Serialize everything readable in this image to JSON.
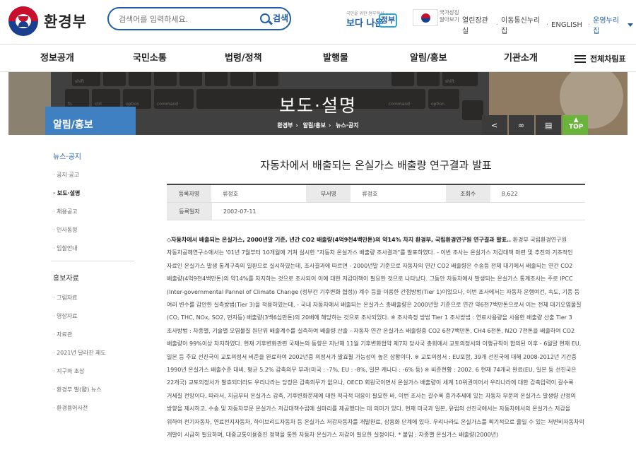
{
  "header": {
    "logo_text": "환경부",
    "search_placeholder": "검색어를 입력하세요.",
    "search_button": "검색",
    "better_gov_small": "국민을 위한 정부혁신",
    "better_gov_big": "보다 나은",
    "better_gov_tag": "정부",
    "flag_text": "국가상징 알아보기",
    "util_links": [
      "열린장관실",
      "이동통신누리집",
      "ENGLISH"
    ],
    "util_ops": "운영누리집"
  },
  "gnb": {
    "items": [
      "정보공개",
      "국민소통",
      "법령/정책",
      "발행물",
      "알림/홍보",
      "기관소개"
    ],
    "all_menu": "전체차림표"
  },
  "banner": {
    "title": "보도·설명",
    "breadcrumb": [
      "환경부",
      "알림/홍보",
      "뉴스·공지"
    ],
    "section": "알림/홍보",
    "top_label": "TOP"
  },
  "lnb": {
    "group1": "뉴스·공지",
    "group1_items": [
      "공지·공고",
      "보도·설명",
      "채용공고",
      "인사동정",
      "입찰안내"
    ],
    "active_item": "보도·설명",
    "group2": "홍보자료",
    "group2_items": [
      "그림자료",
      "영상자료",
      "자료관",
      "2021년 달라진 제도",
      "지구의 초상",
      "환경부 발(發) 뉴스",
      "환경용어사전"
    ]
  },
  "article": {
    "title": "자동차에서 배출되는 온실가스 배출량 연구결과 발표",
    "meta": {
      "author_label": "등록자명",
      "author": "류정호",
      "dept_label": "부서명",
      "dept": "류정호",
      "views_label": "조회수",
      "views": "8,622",
      "date_label": "등록일자",
      "date": "2002-07-11"
    },
    "lead": "◇자동차에서 배출되는 온실가스, 2000년말 기준, 년간 CO2 배출량(4억9천4백만톤)의 약14% 차지 환경부, 국립환경연구원 연구결과 발표..",
    "body": " 환경부 국립환경연구원 자동차공해연구소에서는 '01년 7월부터 10개월에 거쳐 실시한 \"자동차 온실가스 배출량 조사결과\"를 발표하였다. - 이번 조사는 온실가스 저감대책 마련 및 추진의 기초적인 자료인 온실가스 발생 통계구축의 일환으로 실시하였는데, 조사결과에 따르면 - 2000년말 기준으로 자동차의 연간 CO2 배출량은 수송등 전체 대기에서 배출되는 연간 CO2 배출량(4억9천4백만톤)의 약14%를 차지하는 것으로 조사되어 이에 대한 저감대책이 필요한 것으로 나타났다. 그동안 자동차에서 발생되는 온실가스 통계조사는 주로 IPCC (Inter-governmental Pannel of Climate Change (정부간 기후변화 협정)) 계수 등을 이용한 간접방법(Tier 1)이었으나, 이번 조사에서는 자동차 운행여건, 속도, 기종 등 여러 변수를 감안한 실측방법(Tier 3)을 적용하였는데, - 국내 자동차에서 배출되는 온실가스 총배출량은 2000년말 기준으로 연간 약6천7백만톤으로서 이는 전체 대기오염물질(CO, THC, NOx, SO2, 먼지등) 배출량(3백6십만톤)의 20배에 해당하는 것으로 조사되었다. ※ 조사측정 방법 Tier 1 조사방법 : 연료사용량을 사용한 배출량 산출 Tier 3 조사방법 : 차종별, 기술별 오염물질 원단위 배출계수를 실측하여 배출량 산출 - 자동차 연간 온실가스 배출량중 CO2 6천7백만톤, CH4 6천톤, N2O 7천톤을 배출하여 CO2 배출량이 99%이상 차지하였다. 현재 기후변화관련 국제논의 동향은 지난해 11월 기후변화협약 제7차 당사국 총회에서 교토의정서의 이행규칙이 합의된 이후 - 6월말 현재 EU, 일본 등 주요 선진국이 교토의정서 비준을 완료하여 2002년중 의정서가 발효될 가능성이 높은 상황이다. ※ 교토의정서 : EU포함, 39개 선진국에 대해 2008-2012년 기간중 1990년 온실가스 배출수준 대비, 평균 5.2% 감축의무 부과(미국 : -7%, EU : -8%, 일본 캐나다 : -6% 등) ※ 비준현황 : 2002. 6 현재 74개국 완료(EU, 일본 등 선진국은 22개국) 교토의정서가 발효되더라도 우리나라는 당장은 감축의무가 없으나, OECD 회원국이면서 온실가스 배출량이 세계 10위권이어서 우리나라에 대한 감축압력이 갈수록 거세질 전망이다. 따라서, 지금부터 온실가스 감축, 기후변화문제에 대한 적극적 대응이 필요한 바, 이번 조사는 갈수록 증가추세에 있는 자동차 부문의 온실가스 발생량 산정의 방향을 제시하고, 수송 및 자동차부문 온실가스 저감대책수립에 실마리를 제공했다는 데 의미가 있다. 현재 미국과 일본, 유럽의 선진국에서는 자동차에서의 온실가스 저감을 위하여 천기자동차, 연료전지자동차, 하이브리드자동차 등 온실가스 저감자동차를 개발완료, 상용화 단계에 있다. 우리나라도 온실가스를 획기적으로 줄일 수 있는 저변비자동차의 개발이 시급히 필요하며, 대중교통이용증진 정책을 통한 자동차 온실가스 저감이 필요한 실정이다. * 붙임 : 차종별 온실가스 배출량(2000년)"
  }
}
